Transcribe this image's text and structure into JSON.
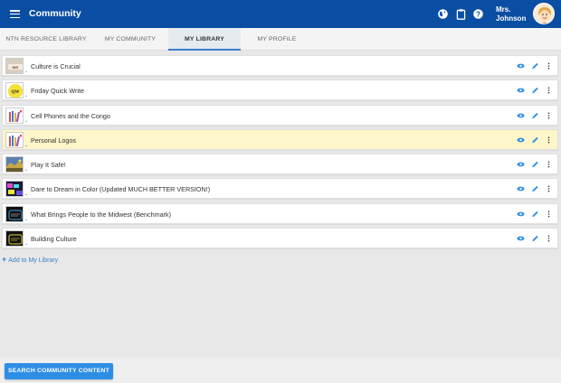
{
  "appbar": {
    "title": "Community",
    "user_name": "Mrs. Johnson",
    "icons": [
      "menu-icon",
      "globe-icon",
      "clipboard-icon",
      "help-icon"
    ]
  },
  "tabs": [
    {
      "label": "NTN RESOURCE LIBRARY",
      "active": false
    },
    {
      "label": "MY COMMUNITY",
      "active": false
    },
    {
      "label": "MY LIBRARY",
      "active": true
    },
    {
      "label": "MY PROFILE",
      "active": false
    }
  ],
  "library": {
    "items": [
      {
        "title": "Culture is Crucial",
        "thumb": "culture-thumbnail",
        "highlighted": false
      },
      {
        "title": "Friday Quick Write",
        "thumb": "qw-thumbnail",
        "highlighted": false
      },
      {
        "title": "Cell Phones and the Congo",
        "thumb": "books-thumbnail",
        "highlighted": false
      },
      {
        "title": "Personal Logos",
        "thumb": "books-thumbnail",
        "highlighted": true
      },
      {
        "title": "Play It Safe!",
        "thumb": "scene-thumbnail",
        "highlighted": false
      },
      {
        "title": "Dare to Dream in Color (Updated MUCH BETTER VERSION!)",
        "thumb": "colorful-thumbnail",
        "highlighted": false
      },
      {
        "title": "What Brings People to the Midwest (Benchmark)",
        "thumb": "chalkboard-thumbnail",
        "highlighted": false
      },
      {
        "title": "Building Culture",
        "thumb": "chalkboard-yellow-thumbnail",
        "highlighted": false
      }
    ],
    "row_actions": [
      "eye-icon",
      "pencil-icon",
      "more-vertical-icon"
    ],
    "add_label": "Add to My Library"
  },
  "footer": {
    "search_button": "SEARCH COMMUNITY CONTENT"
  },
  "colors": {
    "brand": "#0a4ea3",
    "accent": "#2e8ee6",
    "highlight_row": "#fdf6c9"
  }
}
